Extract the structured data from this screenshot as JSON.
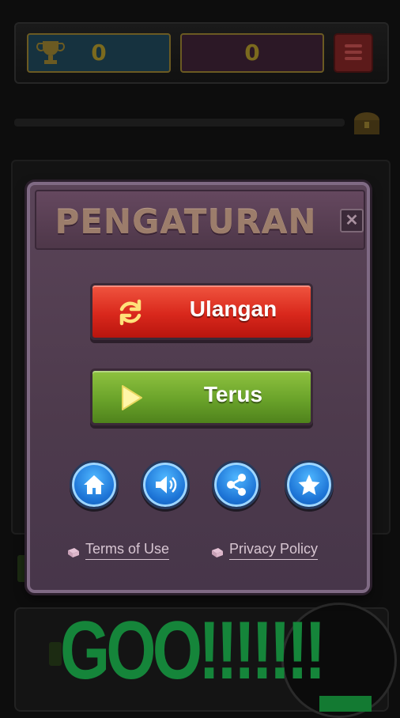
{
  "hud": {
    "score_left": "0",
    "score_right": "0"
  },
  "dialog": {
    "title": "PENGATURAN",
    "close_glyph": "✕",
    "restart_label": "Ulangan",
    "continue_label": "Terus",
    "terms_label": "Terms of Use",
    "privacy_label": "Privacy Policy"
  },
  "overlay": {
    "text": "GOO!!!!!!!"
  },
  "icons": [
    "trophy-icon",
    "menu-icon",
    "treasure-chest-icon",
    "refresh-icon",
    "play-icon",
    "home-icon",
    "speaker-icon",
    "share-icon",
    "star-icon",
    "book-icon"
  ],
  "colors": {
    "dialog_bg": "#4d3a4c",
    "restart_button": "#d9281c",
    "continue_button": "#6aa32a",
    "round_button": "#1d74d6",
    "overlay_text": "#15853a"
  }
}
